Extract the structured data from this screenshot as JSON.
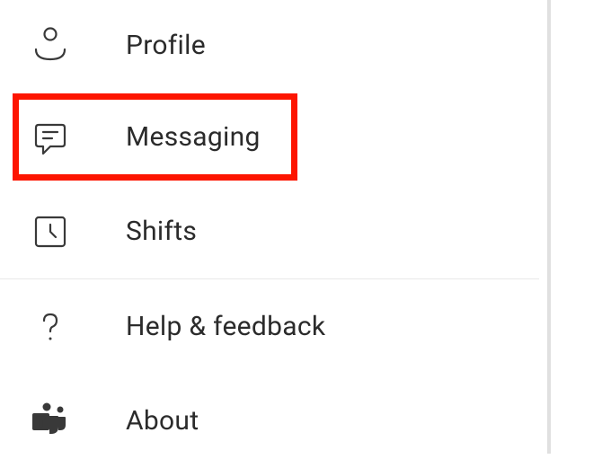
{
  "menu": {
    "profile": {
      "label": "Profile"
    },
    "messaging": {
      "label": "Messaging"
    },
    "shifts": {
      "label": "Shifts"
    },
    "help": {
      "label": "Help & feedback"
    },
    "about": {
      "label": "About"
    }
  },
  "highlight_color": "#fd1500"
}
